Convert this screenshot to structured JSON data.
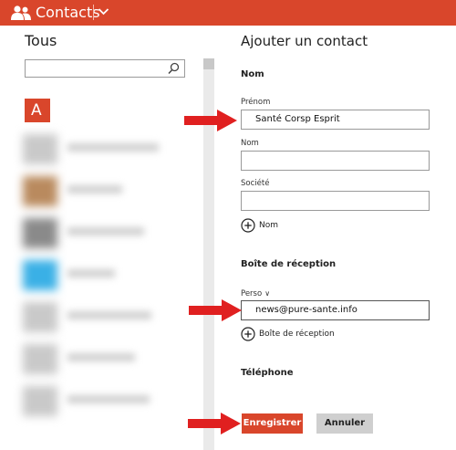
{
  "app": {
    "title": "Contacts",
    "accent_color": "#d9462b",
    "icon": "people-icon",
    "dropdown_icon": "chevron-down-icon"
  },
  "contacts_pane": {
    "title": "Tous",
    "search": {
      "value": "",
      "placeholder": "",
      "icon": "search-icon"
    },
    "group_letter": "A",
    "contacts": [
      {
        "avatar_color": "#c9c9c9"
      },
      {
        "avatar_color": "#b98a5e"
      },
      {
        "avatar_color": "#8a8a8a"
      },
      {
        "avatar_color": "#3ab0e6"
      },
      {
        "avatar_color": "#c9c9c9"
      },
      {
        "avatar_color": "#c9c9c9"
      },
      {
        "avatar_color": "#c9c9c9"
      }
    ]
  },
  "form": {
    "title": "Ajouter un contact",
    "name_section": "Nom",
    "first_name_label": "Prénom",
    "first_name_value": "Santé Corsp Esprit",
    "last_name_label": "Nom",
    "last_name_value": "",
    "company_label": "Société",
    "company_value": "",
    "add_name_label": "Nom",
    "inbox_section": "Boîte de réception",
    "email_type_label": "Perso",
    "email_value": "news@pure-sante.info",
    "add_inbox_label": "Boîte de réception",
    "phone_section": "Téléphone"
  },
  "actions": {
    "save_label": "Enregistrer",
    "cancel_label": "Annuler"
  },
  "annotation_color": "#e02020"
}
